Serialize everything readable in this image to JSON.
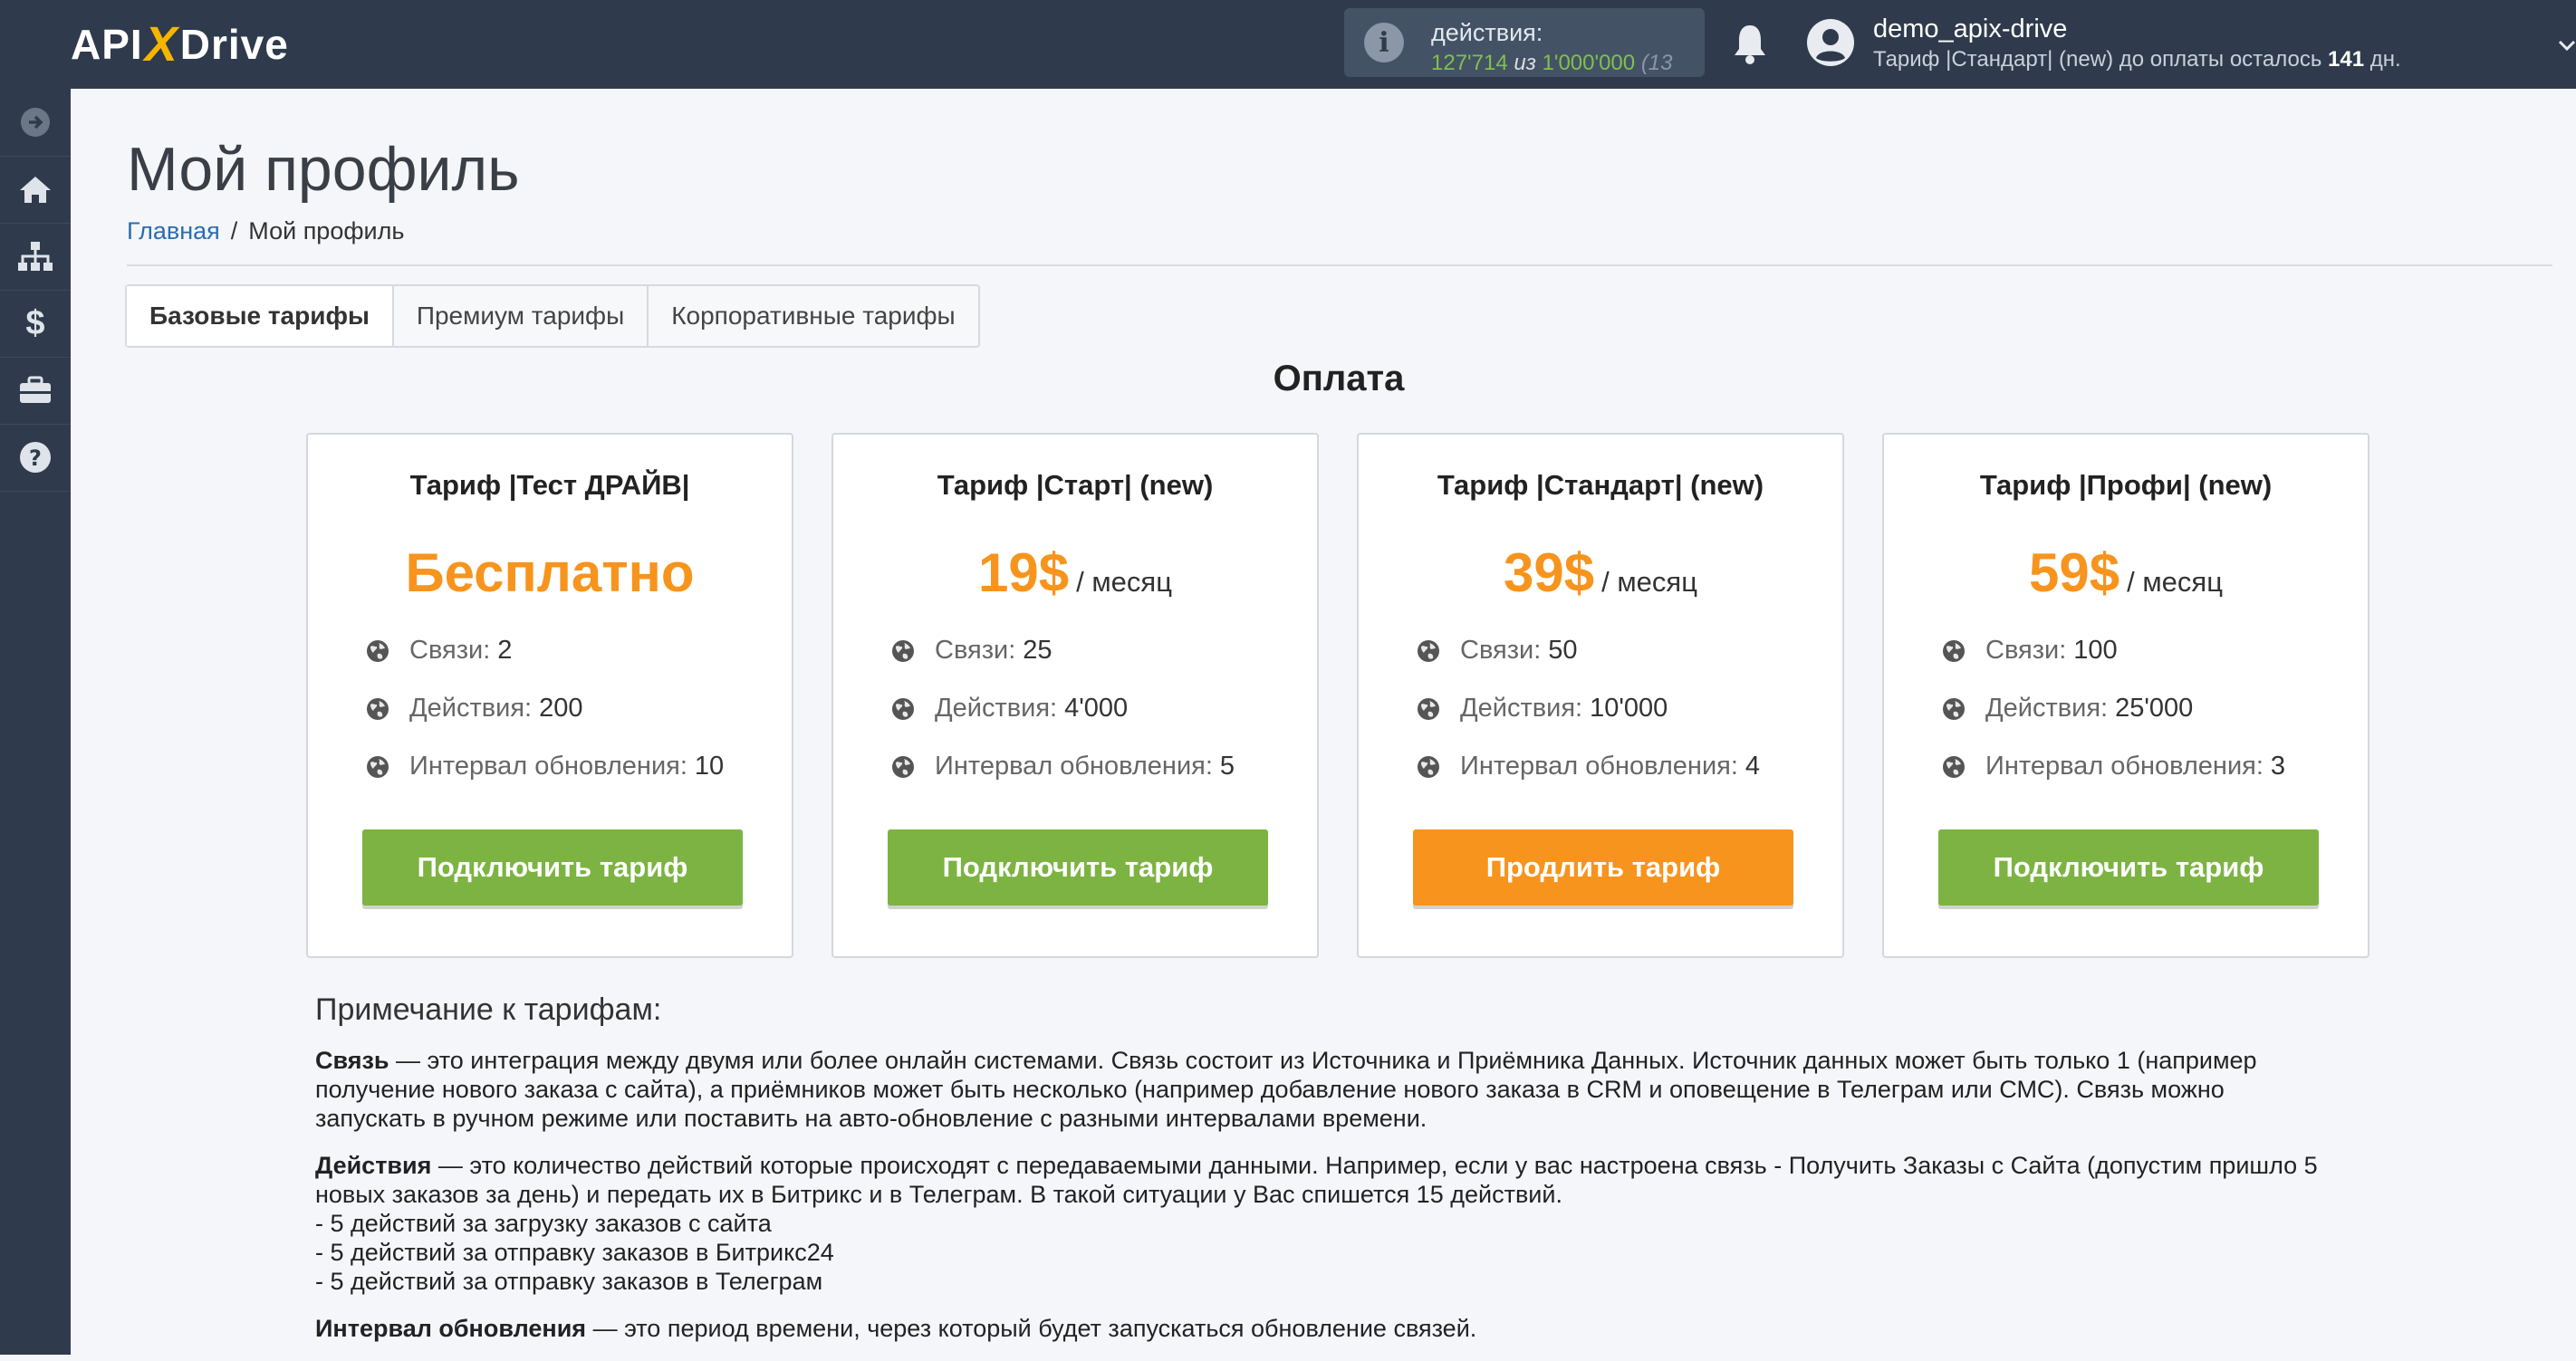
{
  "header": {
    "logo": {
      "part1": "API",
      "part2": "X",
      "part3": "Drive"
    },
    "actions": {
      "label": "действия:",
      "used": "127'714",
      "of": "из",
      "total": "1'000'000",
      "extra": "(13"
    },
    "user": {
      "name": "demo_apix-drive",
      "plan_prefix": "Тариф |Стандарт| (new) до оплаты осталось",
      "days": "141",
      "days_suffix": "дн."
    }
  },
  "sidebar": {
    "items": [
      {
        "icon": "arrow-right-circle-icon"
      },
      {
        "icon": "home-icon"
      },
      {
        "icon": "sitemap-icon"
      },
      {
        "icon": "dollar-icon"
      },
      {
        "icon": "briefcase-icon"
      },
      {
        "icon": "help-icon"
      }
    ]
  },
  "page": {
    "title": "Мой профиль",
    "breadcrumb": {
      "home": "Главная",
      "separator": "/",
      "current": "Мой профиль"
    }
  },
  "tabs": [
    {
      "label": "Базовые тарифы",
      "active": true
    },
    {
      "label": "Премиум тарифы",
      "active": false
    },
    {
      "label": "Корпоративные тарифы",
      "active": false
    }
  ],
  "section_title": "Оплата",
  "plans": [
    {
      "title": "Тариф |Тест ДРАЙВ|",
      "price": "Бесплатно",
      "per": "",
      "features": [
        {
          "label": "Связи:",
          "value": "2"
        },
        {
          "label": "Действия:",
          "value": "200"
        },
        {
          "label": "Интервал обновления:",
          "value": "10"
        }
      ],
      "button": "Подключить тариф",
      "button_color": "#7cb342"
    },
    {
      "title": "Тариф |Старт| (new)",
      "price": "19$",
      "per": "/ месяц",
      "features": [
        {
          "label": "Связи:",
          "value": "25"
        },
        {
          "label": "Действия:",
          "value": "4'000"
        },
        {
          "label": "Интервал обновления:",
          "value": "5"
        }
      ],
      "button": "Подключить тариф",
      "button_color": "#7cb342"
    },
    {
      "title": "Тариф |Стандарт| (new)",
      "price": "39$",
      "per": "/ месяц",
      "features": [
        {
          "label": "Связи:",
          "value": "50"
        },
        {
          "label": "Действия:",
          "value": "10'000"
        },
        {
          "label": "Интервал обновления:",
          "value": "4"
        }
      ],
      "button": "Продлить тариф",
      "button_color": "#f7941d"
    },
    {
      "title": "Тариф |Профи| (new)",
      "price": "59$",
      "per": "/ месяц",
      "features": [
        {
          "label": "Связи:",
          "value": "100"
        },
        {
          "label": "Действия:",
          "value": "25'000"
        },
        {
          "label": "Интервал обновления:",
          "value": "3"
        }
      ],
      "button": "Подключить тариф",
      "button_color": "#7cb342"
    }
  ],
  "notes": {
    "title": "Примечание к тарифам:",
    "connection": {
      "term": "Связь",
      "lines": [
        "— это интеграция между двумя или более онлайн системами. Связь состоит из Источника и Приёмника Данных. Источник данных может быть только 1 (например",
        "получение нового заказа с сайта), а приёмников может быть несколько (например добавление нового заказа в CRM и оповещение в Телеграм или СМС). Связь можно",
        "запускать в ручном режиме или поставить на авто-обновление с разными интервалами времени."
      ]
    },
    "actions": {
      "term": "Действия",
      "lines": [
        "— это количество действий которые происходят с передаваемыми данными. Например, если у вас настроена связь - Получить Заказы с Сайта (допустим пришло 5",
        "новых заказов за день) и передать их в Битрикс и в Телеграм. В такой ситуации у Вас спишется 15 действий.",
        "- 5 действий за загрузку заказов с сайта",
        "- 5 действий за отправку заказов в Битрикс24",
        "- 5 действий за отправку заказов в Телеграм"
      ]
    },
    "interval": {
      "term": "Интервал обновления",
      "text": "— это период времени, через который будет запускаться обновление связей."
    }
  }
}
